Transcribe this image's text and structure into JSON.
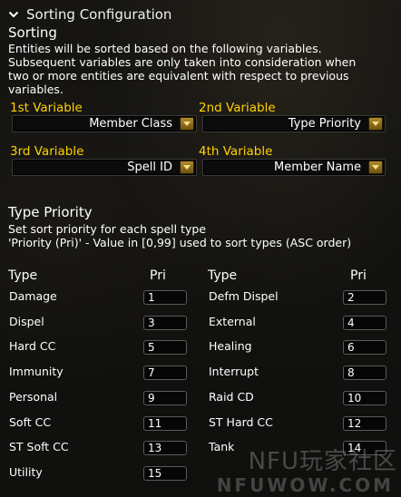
{
  "header": {
    "title": "Sorting Configuration",
    "chevron_icon": "chevron-down-icon"
  },
  "sorting": {
    "title": "Sorting",
    "description": [
      "Entities will be sorted based on the following variables.",
      "Subsequent variables are only taken into consideration when",
      "two or more entities are equivalent with respect to previous",
      "variables."
    ],
    "variables": [
      {
        "label": "1st Variable",
        "value": "Member Class"
      },
      {
        "label": "2nd Variable",
        "value": "Type Priority"
      },
      {
        "label": "3rd Variable",
        "value": "Spell ID"
      },
      {
        "label": "4th Variable",
        "value": "Member Name"
      }
    ]
  },
  "type_priority": {
    "title": "Type Priority",
    "description": [
      "Set sort priority for each spell type",
      "'Priority (Pri)' - Value in [0,99] used to sort types (ASC order)"
    ],
    "col_type": "Type",
    "col_pri": "Pri",
    "left": [
      {
        "type": "Damage",
        "pri": "1"
      },
      {
        "type": "Dispel",
        "pri": "3"
      },
      {
        "type": "Hard CC",
        "pri": "5"
      },
      {
        "type": "Immunity",
        "pri": "7"
      },
      {
        "type": "Personal",
        "pri": "9"
      },
      {
        "type": "Soft CC",
        "pri": "11"
      },
      {
        "type": "ST Soft CC",
        "pri": "13"
      },
      {
        "type": "Utility",
        "pri": "15"
      }
    ],
    "right": [
      {
        "type": "Defm Dispel",
        "pri": "2"
      },
      {
        "type": "External",
        "pri": "4"
      },
      {
        "type": "Healing",
        "pri": "6"
      },
      {
        "type": "Interrupt",
        "pri": "8"
      },
      {
        "type": "Raid CD",
        "pri": "10"
      },
      {
        "type": "ST Hard CC",
        "pri": "12"
      },
      {
        "type": "Tank",
        "pri": "14"
      }
    ]
  },
  "watermark": {
    "line1": "NFU玩家社区",
    "line2": "NFUWOW.COM"
  },
  "colors": {
    "label_gold": "#ffd200",
    "text_white": "#ffffff",
    "background": "#121210"
  }
}
